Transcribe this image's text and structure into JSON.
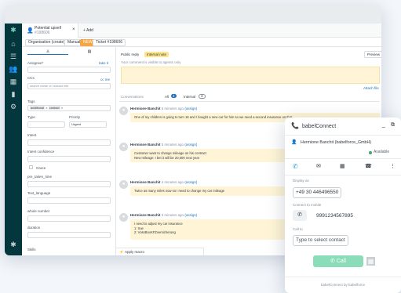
{
  "tabs": {
    "ticket_tab_line1": "Potential upsell",
    "ticket_tab_line2": "#198606",
    "add_label": "+ Add"
  },
  "breadcrumb": {
    "org_label": "Organisation (create)",
    "manual_label": "Manual",
    "status_badge": "NEW",
    "ticket_label": "Ticket #198606"
  },
  "sidebar": {
    "assignee_label": "Assignee*",
    "take_it": "take it",
    "ccs_label": "CCs",
    "cc_me": "cc me",
    "cc_placeholder": "search name or contact info",
    "tags_label": "Tags",
    "tag1": "additional",
    "tag2": "contact",
    "type_label": "Type",
    "type_value": "-",
    "priority_label": "Priority",
    "priority_value": "Urgent",
    "intent_label": "Intent",
    "intent_conf_label": "Intent confidence",
    "grace_label": "Grace",
    "pre_taken_label": "pre_taken_time",
    "text_lang_label": "Text_language",
    "whole_number_label": "whole number",
    "duration_label": "duration",
    "skills_label": "Skills"
  },
  "composer": {
    "public_reply": "Public reply",
    "internal_note": "Internal note",
    "preview": "Preview",
    "visible_notice": "Your comment is visible to agents only",
    "attach": "Attach file"
  },
  "filters": {
    "conversations": "Conversations",
    "all_label": "All",
    "all_count": "4",
    "internal_label": "Internal",
    "internal_count": "4"
  },
  "messages": [
    {
      "author": "Hermione Banchit",
      "time": "6 minutes ago",
      "tag": "(assign)",
      "lines": [
        "One of my children is going to turn 18 and I bought a new car for him so we need a second insurance on that"
      ]
    },
    {
      "author": "Hermione Banchit",
      "time": "5 minutes ago",
      "tag": "(assign)",
      "lines": [
        "Customer want to change mileage on his contract",
        "New mileage: I bet it will be 20,000 next year"
      ]
    },
    {
      "author": "Hermione Banchit",
      "time": "4 minutes ago",
      "tag": "(assign)",
      "lines": [
        "Twice as many miles now so I need to change my car mileage"
      ]
    },
    {
      "author": "Hermione Banchit",
      "time": "3 minutes ago",
      "tag": "(assign)",
      "lines": [
        "I need to adjust my car insurance",
        "1: true",
        "2: VossBoxKFZversicherung"
      ]
    }
  ],
  "apply_macro": "Apply macro",
  "phone": {
    "title": "babelConnect",
    "contact": "Hermione Banchit (babelforce_GmbH)",
    "status": "Available",
    "display_as_label": "Display as",
    "display_as_value": "+49 30 446496550",
    "connect_label": "Connect to mobile",
    "connect_value": "9991234567895",
    "call_to_label": "Call to",
    "call_to_placeholder": "Type to select contact",
    "call_button": "Call",
    "footer": "babelConnect by babelforce"
  },
  "colors": {
    "accent_teal": "#4fc3d4",
    "zendesk_dark": "#03363d",
    "call_green": "#8bdcb8",
    "bubble": "#fff5d6"
  }
}
